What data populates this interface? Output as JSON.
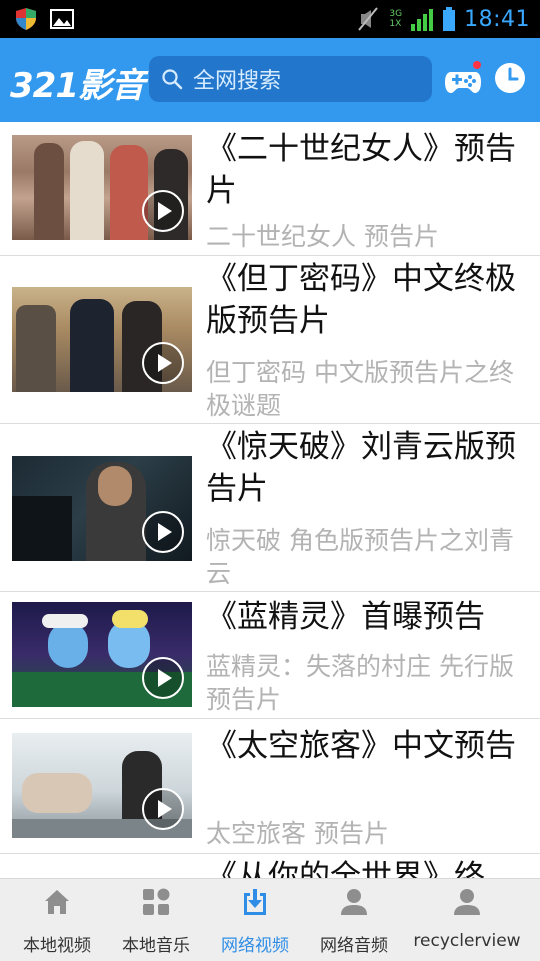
{
  "status_bar": {
    "time": "18:41",
    "network_label": "3G",
    "network_label2": "1X"
  },
  "header": {
    "logo": "321影音",
    "search_placeholder": "全网搜索"
  },
  "videos": [
    {
      "title": "《二十世纪女人》预告片",
      "subtitle": "二十世纪女人 预告片"
    },
    {
      "title": "《但丁密码》中文终极版预告片",
      "subtitle": "但丁密码 中文版预告片之终极谜题"
    },
    {
      "title": "《惊天破》刘青云版预告片",
      "subtitle": "惊天破 角色版预告片之刘青云"
    },
    {
      "title": "《蓝精灵》首曝预告",
      "subtitle": "蓝精灵：失落的村庄 先行版预告片"
    },
    {
      "title": "《太空旅客》中文预告",
      "subtitle": "太空旅客 预告片"
    },
    {
      "title": "《从你的全世界》终",
      "subtitle": ""
    }
  ],
  "bottom_nav": [
    {
      "label": "本地视频",
      "icon": "home-icon",
      "active": false
    },
    {
      "label": "本地音乐",
      "icon": "grid-icon",
      "active": false
    },
    {
      "label": "网络视频",
      "icon": "download-icon",
      "active": true
    },
    {
      "label": "网络音频",
      "icon": "person-icon",
      "active": false
    },
    {
      "label": "recyclerview",
      "icon": "person-icon",
      "active": false
    }
  ],
  "colors": {
    "accent": "#3399ee",
    "search_bg": "#2277cc",
    "active_tab": "#2f8de6",
    "subtitle": "#b3b3b3"
  }
}
